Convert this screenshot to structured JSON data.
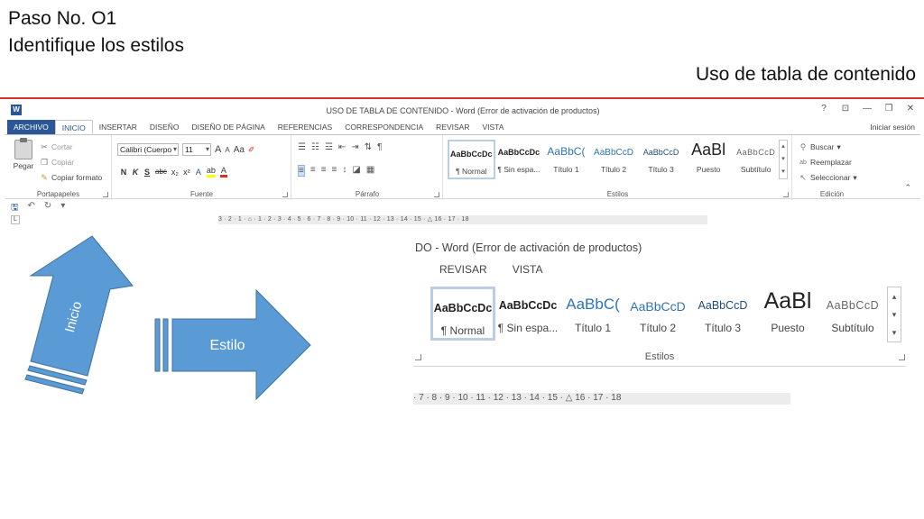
{
  "slide": {
    "title_line1": "Paso No. O1",
    "title_line2": "Identifique los estilos",
    "right_title": "Uso de tabla de contenido",
    "accent_color": "#d9302a"
  },
  "word": {
    "logo": "W",
    "window_title": "USO DE TABLA DE CONTENIDO - Word (Error de activación de productos)",
    "controls": [
      "?",
      "⊡",
      "—",
      "❐",
      "✕"
    ],
    "signin": "Iniciar sesión",
    "tabs": [
      "ARCHIVO",
      "INICIO",
      "INSERTAR",
      "DISEÑO",
      "DISEÑO DE PÁGINA",
      "REFERENCIAS",
      "CORRESPONDENCIA",
      "REVISAR",
      "VISTA"
    ],
    "clipboard": {
      "paste": "Pegar",
      "cut": "Cortar",
      "copy": "Copiar",
      "format_painter": "Copiar formato",
      "label": "Portapapeles"
    },
    "font": {
      "name": "Calibri (Cuerpo",
      "size": "11",
      "grow": "A",
      "shrink": "A",
      "case": "Aa",
      "bold": "N",
      "italic": "K",
      "underline": "S",
      "strike": "abc",
      "sub": "x₂",
      "sup": "x²",
      "effects": "A",
      "highlight": "ab",
      "color": "A",
      "label": "Fuente"
    },
    "paragraph": {
      "label": "Párrafo"
    },
    "styles": {
      "label": "Estilos",
      "items": [
        {
          "sample": "AaBbCcDc",
          "name": "¶ Normal"
        },
        {
          "sample": "AaBbCcDc",
          "name": "¶ Sin espa..."
        },
        {
          "sample": "AaBbC(",
          "name": "Título 1"
        },
        {
          "sample": "AaBbCcD",
          "name": "Título 2"
        },
        {
          "sample": "AaBbCcD",
          "name": "Título 3"
        },
        {
          "sample": "AaBl",
          "name": "Puesto"
        },
        {
          "sample": "AaBbCcD",
          "name": "Subtítulo"
        }
      ],
      "heading_color": "#2e74b5"
    },
    "editing": {
      "find": "Buscar",
      "replace": "Reemplazar",
      "select": "Seleccionar",
      "label": "Edición"
    },
    "ruler_main": "3 · 2 · 1 · ⌂ · 1 · 2 · 3 · 4 · 5 · 6 · 7 · 8 · 9 · 10 · 11 · 12 · 13 · 14 · 15 · △ 16 · 17 · 18"
  },
  "arrows": {
    "up_label": "Inicio",
    "right_label": "Estilo",
    "fill": "#5b9bd5",
    "stroke": "#41719c"
  },
  "zoom": {
    "title": "DO - Word (Error de activación de productos)",
    "tabs": [
      "REVISAR",
      "VISTA"
    ],
    "ruler": "· 7 · 8 · 9 · 10 · 11 · 12 · 13 · 14 · 15 · △ 16 · 17 · 18"
  }
}
